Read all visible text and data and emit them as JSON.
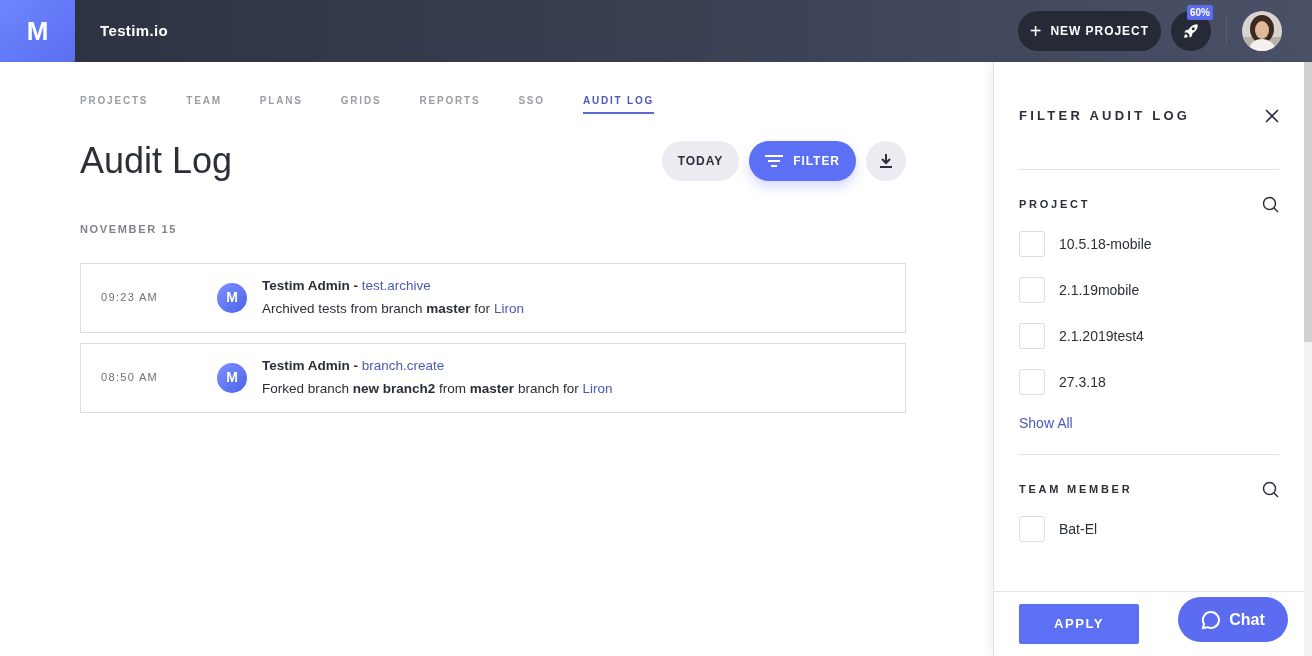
{
  "header": {
    "logo": "M",
    "app_name": "Testim.io",
    "new_project_button": "NEW PROJECT",
    "plus": "+",
    "usage_badge": "60%"
  },
  "nav_tabs": [
    {
      "label": "PROJECTS",
      "selected": false
    },
    {
      "label": "TEAM",
      "selected": false
    },
    {
      "label": "PLANS",
      "selected": false
    },
    {
      "label": "GRIDS",
      "selected": false
    },
    {
      "label": "REPORTS",
      "selected": false
    },
    {
      "label": "SSO",
      "selected": false
    },
    {
      "label": "AUDIT LOG",
      "selected": true
    }
  ],
  "page_title": "Audit Log",
  "toolbar": {
    "today_button": "TODAY",
    "filter_button": "FILTER"
  },
  "date_heading": "NOVEMBER 15",
  "entries": [
    {
      "time": "09:23 AM",
      "avatar": "M",
      "actor": "Testim Admin - ",
      "action": "test.archive",
      "description": "Archived tests from branch **master** for ",
      "user": "Liron"
    },
    {
      "time": "08:50 AM",
      "avatar": "M",
      "actor": "Testim Admin - ",
      "action": "branch.create",
      "description": "Forked branch **new branch2** from **master** branch for ",
      "user": "Liron"
    }
  ],
  "filter_panel": {
    "title": "FILTER AUDIT LOG",
    "sections": [
      {
        "heading": "PROJECT",
        "options": [
          {
            "label": "10.5.18-mobile",
            "checked": false
          },
          {
            "label": "2.1.19mobile",
            "checked": false
          },
          {
            "label": "2.1.2019test4",
            "checked": false
          },
          {
            "label": "27.3.18",
            "checked": false
          }
        ],
        "show_all": "Show All"
      },
      {
        "heading": "TEAM MEMBER",
        "options": [
          {
            "label": "Bat-El",
            "checked": false
          }
        ]
      }
    ],
    "apply_button": "APPLY"
  },
  "chat_button": "Chat"
}
